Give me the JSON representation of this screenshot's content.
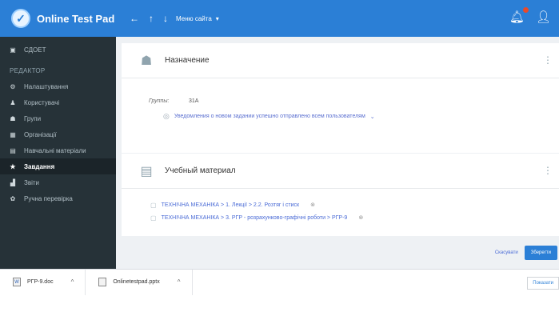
{
  "topbar": {
    "brand": "Online Test Pad",
    "logo_glyph": "✓",
    "back_icon": "←",
    "up_icon": "↑",
    "down_icon": "↓",
    "menu_label": "Меню сайта",
    "menu_chevron": "▾"
  },
  "sidebar": {
    "top_item": {
      "icon": "▣",
      "label": "СДОЕТ"
    },
    "section": "РЕДАКТОР",
    "items": [
      {
        "icon": "⚙",
        "label": "Налаштування"
      },
      {
        "icon": "♟",
        "label": "Користувачі"
      },
      {
        "icon": "☗",
        "label": "Групи"
      },
      {
        "icon": "▦",
        "label": "Організації"
      },
      {
        "icon": "▤",
        "label": "Навчальні матеріали"
      },
      {
        "icon": "★",
        "label": "Завдання",
        "active": true
      },
      {
        "icon": "▟",
        "label": "Звіти"
      },
      {
        "icon": "✿",
        "label": "Ручна перевірка"
      }
    ]
  },
  "assignment_card": {
    "title": "Назначение",
    "groups_label": "Группы:",
    "groups_value": "31А",
    "notice": "Уведомления о новом задании успешно отправлено всем пользователям",
    "notice_chevron": "⌄"
  },
  "material_card": {
    "title": "Учебный материал",
    "items": [
      {
        "text": "ТЕХНІЧНА МЕХАНІКА > 1. Лекції > 2.2. Розтяг і стиск",
        "remove": "⊗"
      },
      {
        "text": "ТЕХНІЧНА МЕХАНІКА > 3. РГР - розрахунково-графічні роботи > РГР-9",
        "remove": "⊗"
      }
    ]
  },
  "footer": {
    "cancel": "Скасувати",
    "save": "Зберегти"
  },
  "downloads": {
    "items": [
      {
        "name": "РГР-9.doc",
        "chevron": "^"
      },
      {
        "name": "Onlinetestpad.pptx",
        "chevron": "^"
      }
    ],
    "show_all": "Показати"
  }
}
